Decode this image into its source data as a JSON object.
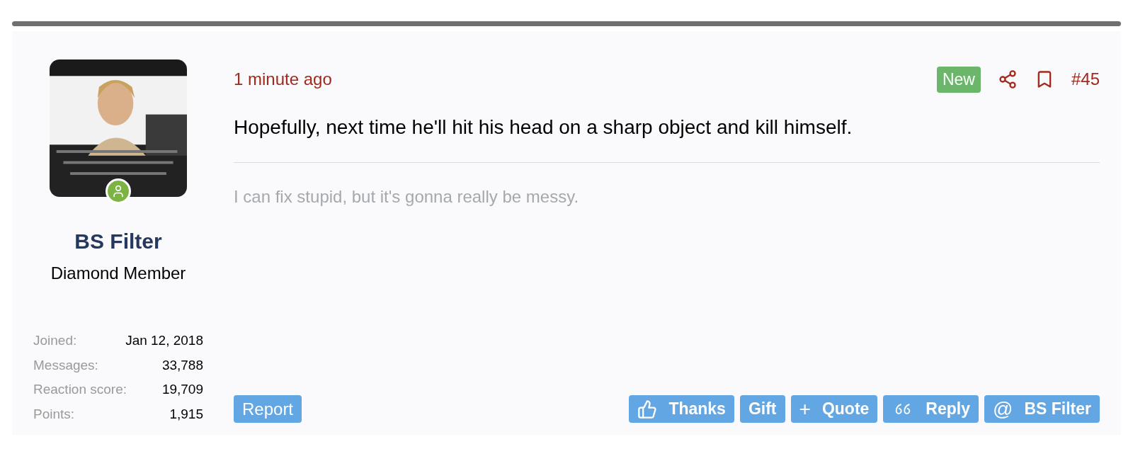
{
  "user": {
    "online": true,
    "name": "BS Filter",
    "title": "Diamond Member",
    "stats": [
      {
        "label": "Joined:",
        "value": "Jan 12, 2018"
      },
      {
        "label": "Messages:",
        "value": "33,788"
      },
      {
        "label": "Reaction score:",
        "value": "19,709"
      },
      {
        "label": "Points:",
        "value": "1,915"
      }
    ]
  },
  "post": {
    "time": "1 minute ago",
    "badge": "New",
    "number": "#45",
    "message": "Hopefully, next time he'll hit his head on a sharp object and kill himself.",
    "signature": "I can fix stupid, but it's gonna really be messy."
  },
  "report": "Report",
  "actions": [
    {
      "kind": "thumb",
      "label": "Thanks"
    },
    {
      "kind": "plain",
      "label": "Gift"
    },
    {
      "kind": "glyph",
      "glyph": "+",
      "label": "Quote"
    },
    {
      "kind": "quote-mark",
      "label": "Reply"
    },
    {
      "kind": "glyph",
      "glyph": "@",
      "label": "BS Filter"
    }
  ]
}
